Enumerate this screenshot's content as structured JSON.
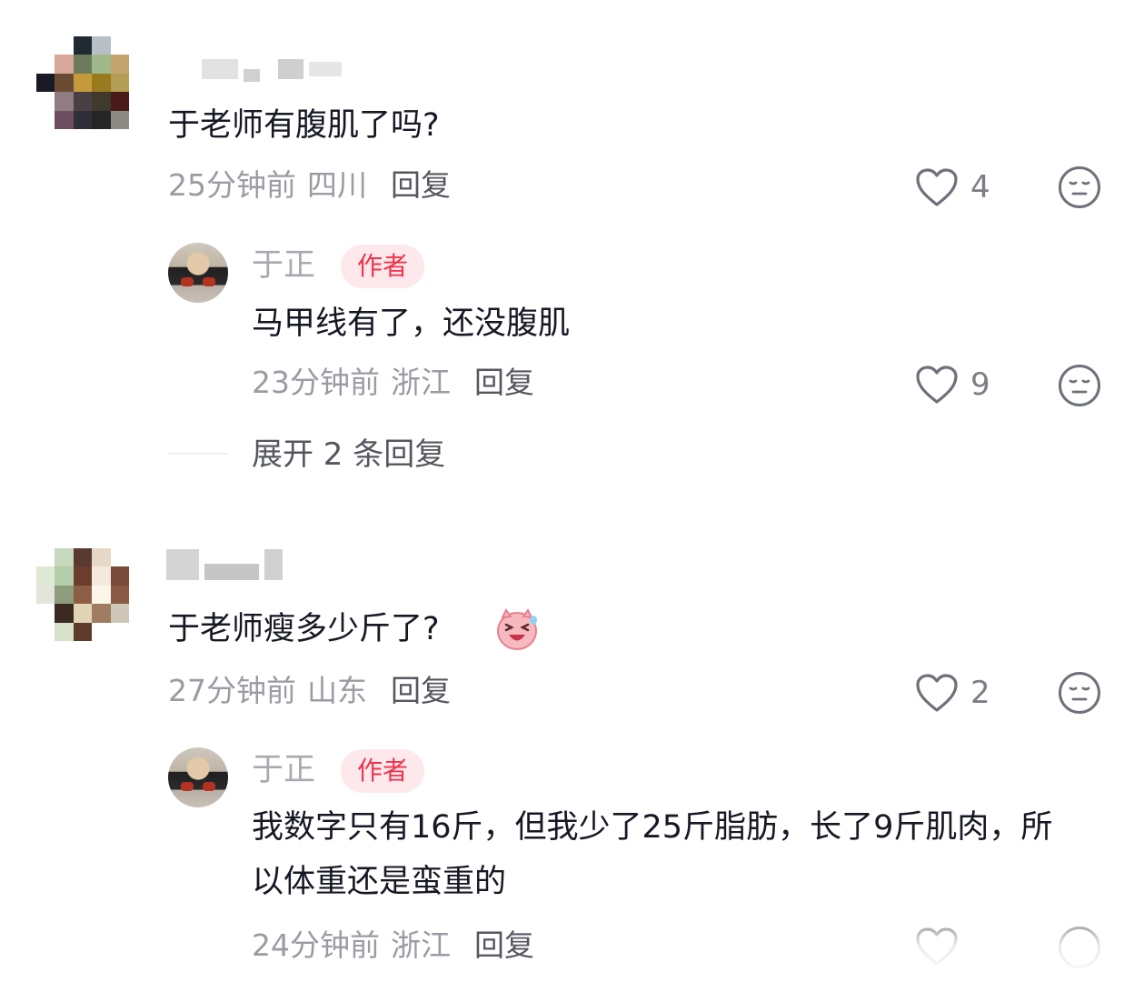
{
  "comments": [
    {
      "text": "于老师有腹肌了吗?",
      "time": "25分钟前",
      "location": "四川",
      "reply_label": "回复",
      "likes": "4",
      "author_reply": {
        "name": "于正",
        "badge": "作者",
        "text": "马甲线有了，还没腹肌",
        "time": "23分钟前",
        "location": "浙江",
        "reply_label": "回复",
        "likes": "9"
      },
      "expand_label": "展开 2 条回复"
    },
    {
      "text": "于老师瘦多少斤了?",
      "time": "27分钟前",
      "location": "山东",
      "reply_label": "回复",
      "likes": "2",
      "author_reply": {
        "name": "于正",
        "badge": "作者",
        "text": "我数字只有16斤，但我少了25斤脂肪，长了9斤肌肉，所以体重还是蛮重的",
        "time": "24分钟前",
        "location": "浙江",
        "reply_label": "回复"
      }
    }
  ],
  "icons": {
    "like": "heart-outline-icon",
    "emoji": "neutral-face-icon",
    "sticker": "laughing-pig-sticker"
  },
  "colors": {
    "badge_text": "#f0324a",
    "badge_bg": "#fde8ec",
    "meta_text": "#9a9ca3"
  }
}
